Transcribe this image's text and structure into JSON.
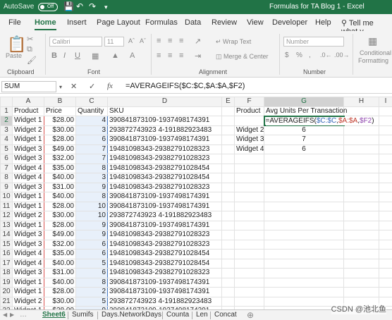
{
  "titlebar": {
    "autosave": "AutoSave",
    "toggle": "Off",
    "title": "Formulas for TA Blog 1  -  Excel"
  },
  "ribbon_tabs": [
    "File",
    "Home",
    "Insert",
    "Page Layout",
    "Formulas",
    "Data",
    "Review",
    "View",
    "Developer",
    "Help"
  ],
  "tell_me": "Tell me what y",
  "ribbon": {
    "clipboard": "Clipboard",
    "paste": "Paste",
    "font_group": "Font",
    "font_name": "Calibri",
    "font_size": "11",
    "alignment": "Alignment",
    "wrap": "Wrap Text",
    "merge": "Merge & Center",
    "number_group": "Number",
    "number_format": "Number",
    "conditional": "Conditional",
    "formatting": "Formatting"
  },
  "formula_bar": {
    "name_box": "SUM",
    "fx": "fx",
    "formula": "=AVERAGEIFS($C:$C,$A:$A,$F2)"
  },
  "columns": [
    "A",
    "B",
    "C",
    "D",
    "E",
    "F",
    "G",
    "H",
    "I"
  ],
  "rows": [
    [
      "Product",
      "Price",
      "Quantity",
      "SKU",
      "",
      "Product",
      "Avg Units Per Transaction",
      "",
      ""
    ],
    [
      "Widget 1",
      "$28.00",
      "4",
      "390841873109-1937498174391",
      "",
      "",
      "",
      "",
      ""
    ],
    [
      "Widget 2",
      "$30.00",
      "3",
      "293872743923 4-191882923483",
      "",
      "Widget 2",
      "6",
      "",
      ""
    ],
    [
      "Widget 1",
      "$28.00",
      "6",
      "390841873109-1937498174391",
      "",
      "Widget 3",
      "7",
      "",
      ""
    ],
    [
      "Widget 3",
      "$49.00",
      "7",
      "19481098343-29382791028323",
      "",
      "Widget 4",
      "6",
      "",
      ""
    ],
    [
      "Widget 3",
      "$32.00",
      "7",
      "19481098343-29382791028323",
      "",
      "",
      "",
      "",
      ""
    ],
    [
      "Widget 4",
      "$35.00",
      "8",
      "19481098343-29382791028454",
      "",
      "",
      "",
      "",
      ""
    ],
    [
      "Widget 4",
      "$40.00",
      "3",
      "19481098343-29382791028454",
      "",
      "",
      "",
      "",
      ""
    ],
    [
      "Widget 3",
      "$31.00",
      "9",
      "19481098343-29382791028323",
      "",
      "",
      "",
      "",
      ""
    ],
    [
      "Widget 1",
      "$40.00",
      "8",
      "390841873109-1937498174391",
      "",
      "",
      "",
      "",
      ""
    ],
    [
      "Widget 1",
      "$28.00",
      "10",
      "390841873109-1937498174391",
      "",
      "",
      "",
      "",
      ""
    ],
    [
      "Widget 2",
      "$30.00",
      "10",
      "293872743923 4-191882923483",
      "",
      "",
      "",
      "",
      ""
    ],
    [
      "Widget 1",
      "$28.00",
      "9",
      "390841873109-1937498174391",
      "",
      "",
      "",
      "",
      ""
    ],
    [
      "Widget 3",
      "$49.00",
      "9",
      "19481098343-29382791028323",
      "",
      "",
      "",
      "",
      ""
    ],
    [
      "Widget 3",
      "$32.00",
      "6",
      "19481098343-29382791028323",
      "",
      "",
      "",
      "",
      ""
    ],
    [
      "Widget 4",
      "$35.00",
      "6",
      "19481098343-29382791028454",
      "",
      "",
      "",
      "",
      ""
    ],
    [
      "Widget 4",
      "$40.00",
      "5",
      "19481098343-29382791028454",
      "",
      "",
      "",
      "",
      ""
    ],
    [
      "Widget 3",
      "$31.00",
      "6",
      "19481098343-29382791028323",
      "",
      "",
      "",
      "",
      ""
    ],
    [
      "Widget 1",
      "$40.00",
      "8",
      "390841873109-1937498174391",
      "",
      "",
      "",
      "",
      ""
    ],
    [
      "Widget 1",
      "$28.00",
      "2",
      "390841873109-1937498174391",
      "",
      "",
      "",
      "",
      ""
    ],
    [
      "Widget 2",
      "$30.00",
      "5",
      "293872743923 4-191882923483",
      "",
      "",
      "",
      "",
      ""
    ],
    [
      "Widget 1",
      "$28.00",
      "9",
      "390841873109-1937498174391",
      "",
      "",
      "",
      "",
      ""
    ]
  ],
  "editing_cell": {
    "p1": "=AVERAGEIFS(",
    "p2": "$C:$C",
    "p3": ",",
    "p4": "$A:$A",
    "p5": ",",
    "p6": "$F2",
    "p7": ")"
  },
  "sheet_tabs": [
    "Sheet6",
    "Sumifs",
    "Days.NetworkDays",
    "Counta",
    "Len",
    "Concat"
  ],
  "watermark": "CSDN @池北鱼",
  "colors": {
    "accent": "#217346",
    "range_a": "#d9534f",
    "range_c": "#4a7cc4"
  }
}
